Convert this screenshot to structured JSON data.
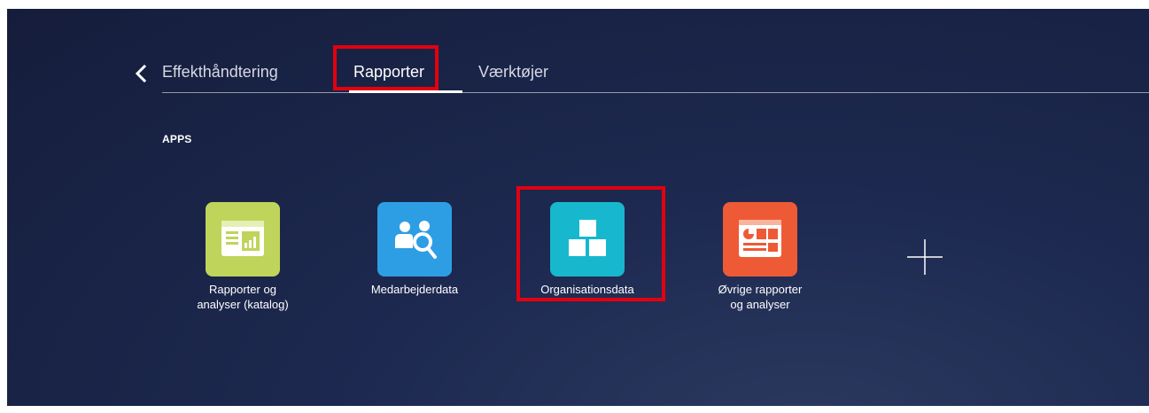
{
  "nav": {
    "back_icon": "chevron-left-icon",
    "tabs": [
      {
        "label": "Effekthåndtering",
        "active": false
      },
      {
        "label": "Rapporter",
        "active": true
      },
      {
        "label": "Værktøjer",
        "active": false
      }
    ]
  },
  "apps_section": {
    "heading": "APPS",
    "tiles": [
      {
        "label": "Rapporter og\nanalyser (katalog)",
        "icon": "report-catalog-icon",
        "color": "#bfd45a"
      },
      {
        "label": "Medarbejderdata",
        "icon": "employee-search-icon",
        "color": "#2e9ee4"
      },
      {
        "label": "Organisationsdata",
        "icon": "org-blocks-icon",
        "color": "#17b8ce"
      },
      {
        "label": "Øvrige rapporter\nog analyser",
        "icon": "dashboard-report-icon",
        "color": "#ee5a35"
      }
    ],
    "add_icon": "plus-icon"
  },
  "colors": {
    "highlight": "#e3000f",
    "background": "#1d2950"
  }
}
